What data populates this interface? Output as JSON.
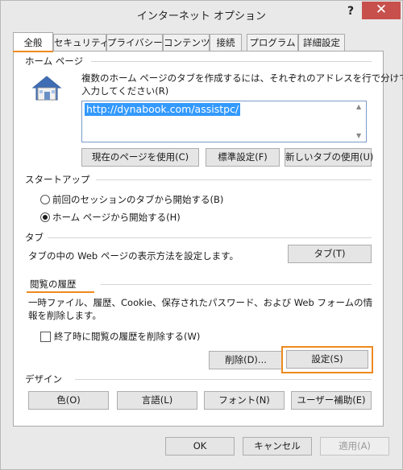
{
  "window": {
    "title": "インターネット オプション",
    "help_label": "?",
    "close_label": "✕"
  },
  "tabs": [
    {
      "label": "全般",
      "active": true
    },
    {
      "label": "セキュリティ"
    },
    {
      "label": "プライバシー"
    },
    {
      "label": "コンテンツ"
    },
    {
      "label": "接続"
    },
    {
      "label": "プログラム"
    },
    {
      "label": "詳細設定"
    }
  ],
  "home_page": {
    "group_label": "ホーム ページ",
    "description_line1": "複数のホーム ページのタブを作成するには、それぞれのアドレスを行で分けて",
    "description_line2": "入力してください(R)",
    "url_value": "http://dynabook.com/assistpc/",
    "use_current_button": "現在のページを使用(C)",
    "use_default_button": "標準設定(F)",
    "use_new_tab_button": "新しいタブの使用(U)"
  },
  "startup": {
    "group_label": "スタートアップ",
    "option1": "前回のセッションのタブから開始する(B)",
    "option2": "ホーム ページから開始する(H)",
    "selected": "option2"
  },
  "tabs_section": {
    "group_label": "タブ",
    "description": "タブの中の Web ページの表示方法を設定します。",
    "tabs_button": "タブ(T)"
  },
  "history": {
    "group_label": "閲覧の履歴",
    "description_line1": "一時ファイル、履歴、Cookie、保存されたパスワード、および Web フォームの情",
    "description_line2": "報を削除します。",
    "delete_on_exit_label": "終了時に閲覧の履歴を削除する(W)",
    "delete_on_exit_checked": false,
    "delete_button": "削除(D)...",
    "settings_button": "設定(S)"
  },
  "design": {
    "group_label": "デザイン",
    "colors_button": "色(O)",
    "languages_button": "言語(L)",
    "fonts_button": "フォント(N)",
    "accessibility_button": "ユーザー補助(E)"
  },
  "footer": {
    "ok_button": "OK",
    "cancel_button": "キャンセル",
    "apply_button": "適用(A)"
  },
  "colors": {
    "highlight": "#ee8a1e",
    "close_button": "#c7504d",
    "selection": "#3399ff"
  }
}
